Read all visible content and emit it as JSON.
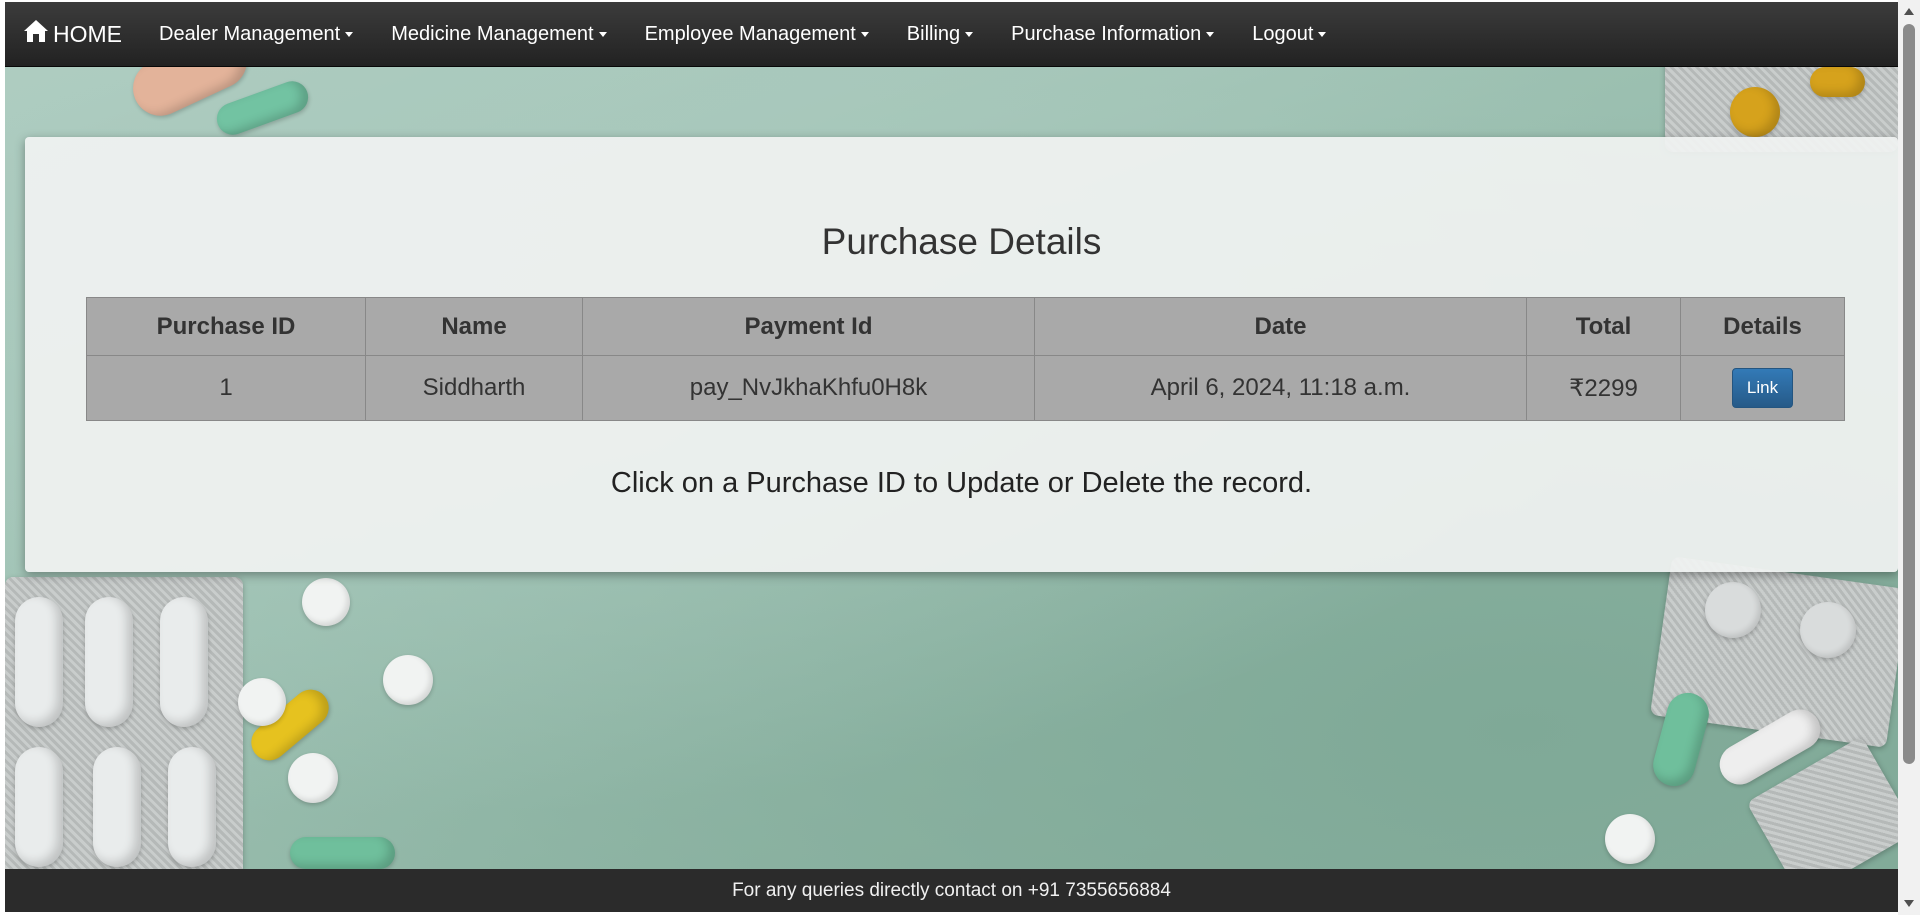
{
  "navbar": {
    "home_label": "HOME",
    "items": [
      {
        "label": "Dealer Management"
      },
      {
        "label": "Medicine Management"
      },
      {
        "label": "Employee Management"
      },
      {
        "label": "Billing"
      },
      {
        "label": "Purchase Information"
      },
      {
        "label": "Logout"
      }
    ]
  },
  "panel": {
    "title": "Purchase Details",
    "columns": [
      "Purchase ID",
      "Name",
      "Payment Id",
      "Date",
      "Total",
      "Details"
    ],
    "rows": [
      {
        "purchase_id": "1",
        "name": "Siddharth",
        "payment_id": "pay_NvJkhaKhfu0H8k",
        "date": "April 6, 2024, 11:18 a.m.",
        "total": "₹2299",
        "details_label": "Link"
      }
    ],
    "note": "Click on a Purchase ID to Update or Delete the record."
  },
  "footer": {
    "text": "For any queries directly contact on +91 7355656884"
  },
  "icons": {
    "home": "home-icon",
    "caret": "caret-down-icon"
  },
  "colors": {
    "navbar_bg": "#222222",
    "button_primary": "#337ab7",
    "table_bg": "#a9a9a9",
    "footer_bg": "#2b2b2b"
  }
}
